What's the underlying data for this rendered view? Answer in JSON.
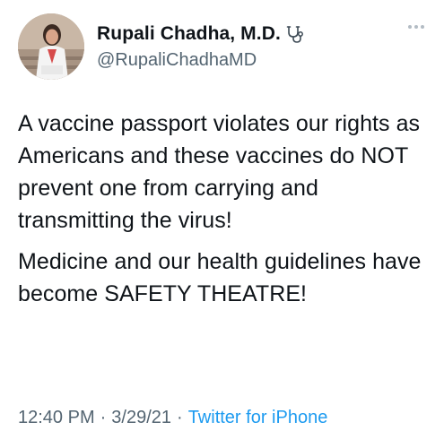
{
  "author": {
    "display_name": "Rupali Chadha, M.D.",
    "handle": "@RupaliChadhaMD",
    "badge_icon": "stethoscope-icon"
  },
  "tweet": {
    "paragraphs": [
      "A vaccine passport violates our rights as Americans and these vaccines do NOT prevent one from carrying and transmitting the virus!",
      "Medicine and our health guidelines have become SAFETY THEATRE!"
    ]
  },
  "meta": {
    "time": "12:40 PM",
    "date": "3/29/21",
    "separator": "·",
    "source": "Twitter for iPhone"
  },
  "colors": {
    "text": "#0f1419",
    "secondary": "#536471",
    "link": "#1d9bf0"
  }
}
